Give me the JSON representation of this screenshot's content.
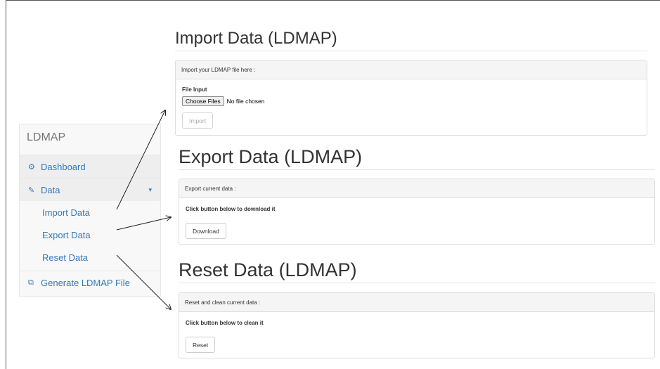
{
  "sidebar": {
    "brand": "LDMAP",
    "items": [
      {
        "label": "Dashboard",
        "icon": "dashboard-icon"
      },
      {
        "label": "Data",
        "icon": "edit-icon"
      },
      {
        "label": "Generate LDMAP File",
        "icon": "copy-file-icon"
      }
    ],
    "sub_items": [
      "Import Data",
      "Export Data",
      "Reset Data"
    ]
  },
  "import": {
    "title": "Import Data (LDMAP)",
    "panel_header": "Import your LDMAP file here :",
    "field_label": "File Input",
    "choose_button": "Choose Files",
    "file_status": "No file chosen",
    "import_button": "Import"
  },
  "export": {
    "title": "Export Data (LDMAP)",
    "panel_header": "Export current data :",
    "instruction": "Click button below to download it",
    "download_button": "Download"
  },
  "reset": {
    "title": "Reset Data (LDMAP)",
    "panel_header": "Reset and clean current data :",
    "instruction": "Click button below to clean it",
    "reset_button": "Reset"
  },
  "colors": {
    "link": "#337ab7",
    "panel_head": "#f5f5f5",
    "border": "#dddddd"
  }
}
